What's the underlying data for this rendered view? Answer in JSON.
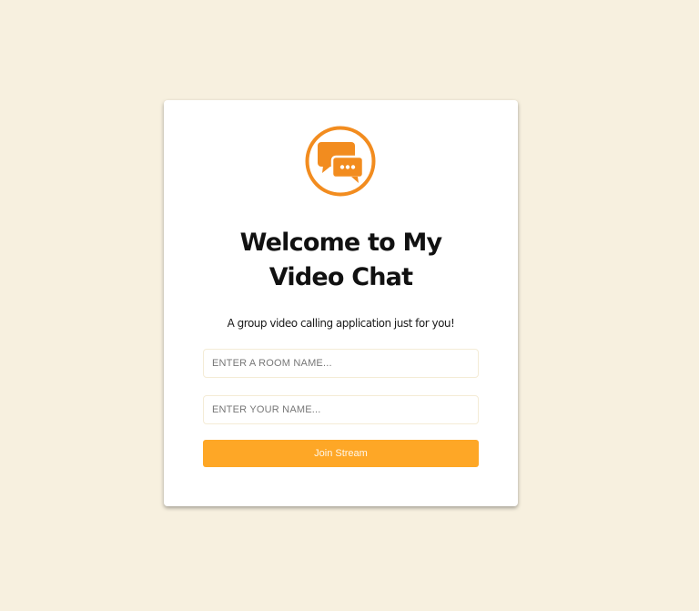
{
  "colors": {
    "page_background": "#f7f0df",
    "card_background": "#ffffff",
    "accent": "#f28c1f",
    "button": "#fea726"
  },
  "logo": {
    "icon": "chat-bubbles-icon"
  },
  "welcome": {
    "title": "Welcome to My Video Chat",
    "subtitle": "A group video calling application just for you!"
  },
  "form": {
    "room_placeholder": "ENTER A ROOM NAME...",
    "room_value": "",
    "name_placeholder": "ENTER YOUR NAME...",
    "name_value": "",
    "submit_label": "Join Stream"
  }
}
